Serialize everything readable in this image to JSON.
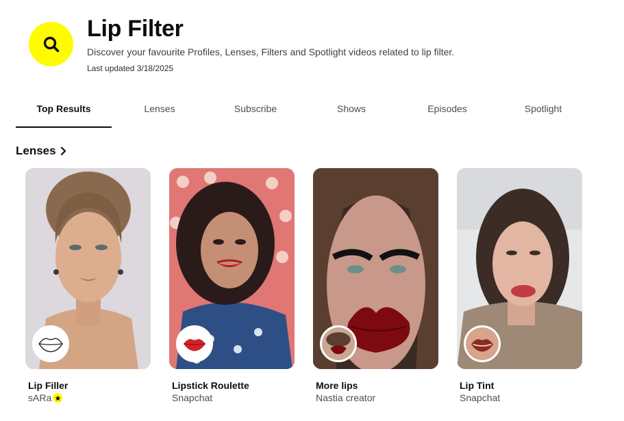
{
  "header": {
    "title": "Lip Filter",
    "description": "Discover your favourite Profiles, Lenses, Filters and Spotlight videos related to lip filter.",
    "last_updated": "Last updated 3/18/2025",
    "search_icon": "search-icon",
    "badge_color": "#FFFC00"
  },
  "tabs": [
    {
      "label": "Top Results",
      "active": true
    },
    {
      "label": "Lenses"
    },
    {
      "label": "Subscribe"
    },
    {
      "label": "Shows"
    },
    {
      "label": "Episodes"
    },
    {
      "label": "Spotlight"
    }
  ],
  "section": {
    "title": "Lenses",
    "icon": "chevron-right-icon"
  },
  "lenses": [
    {
      "name": "Lip Filler",
      "creator": "sARa",
      "verified_icon": "star-icon"
    },
    {
      "name": "Lipstick Roulette",
      "creator": "Snapchat"
    },
    {
      "name": "More lips",
      "creator": "Nastia creator"
    },
    {
      "name": "Lip Tint",
      "creator": "Snapchat"
    }
  ]
}
